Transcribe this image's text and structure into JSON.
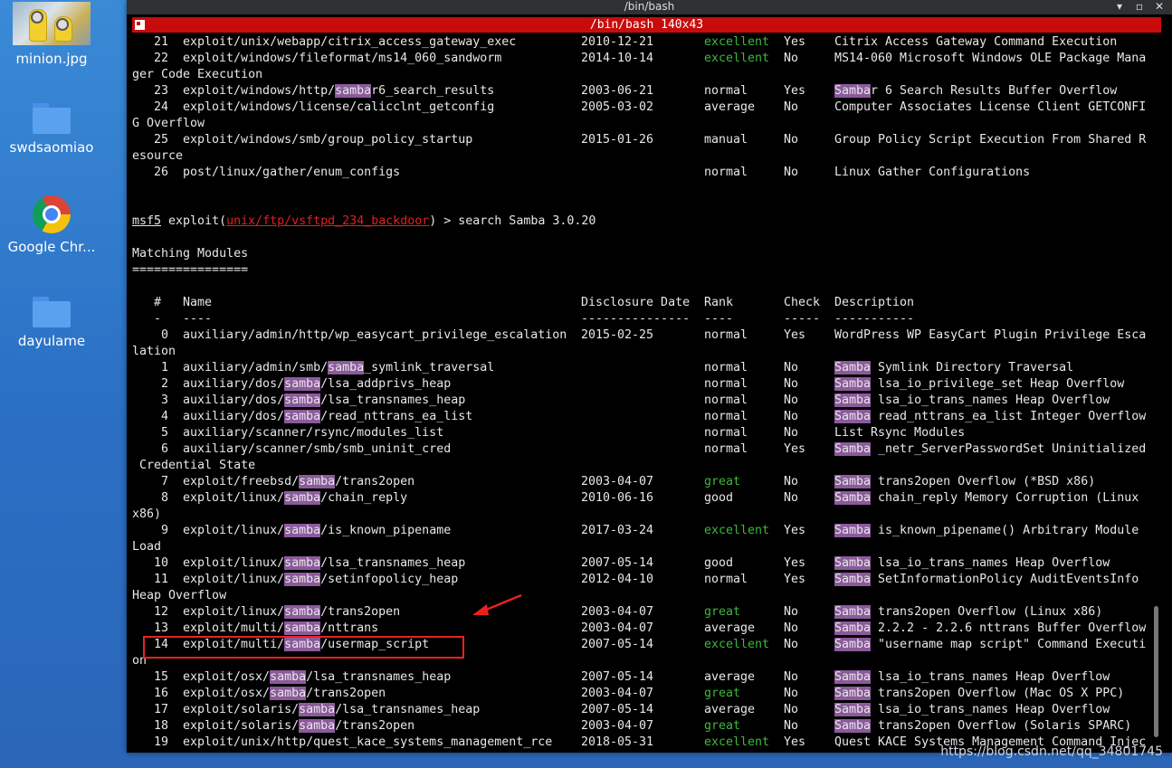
{
  "desktop": {
    "icons": [
      {
        "label": "minion.jpg",
        "icon": "image-thumbnail-icon"
      },
      {
        "label": "swdsaomiao",
        "icon": "folder-icon"
      },
      {
        "label": "Google Chr...",
        "icon": "chrome-icon"
      },
      {
        "label": "dayulame",
        "icon": "folder-icon"
      }
    ]
  },
  "window": {
    "title": "/bin/bash",
    "tab_title": "/bin/bash 140x43",
    "controls": [
      "▾",
      "▫",
      "✕"
    ]
  },
  "colors": {
    "accent_red": "#c80b0b",
    "highlight": "#8b5a9b",
    "rating_green": "#3cb83c",
    "annotation_red": "#e8231e"
  },
  "terminal": {
    "top_rows": [
      {
        "num": "21",
        "name": "exploit/unix/webapp/citrix_access_gateway_exec",
        "date": "2010-12-21",
        "rank": "excellent",
        "check": "Yes",
        "desc": "Citrix Access Gateway Command Execution"
      },
      {
        "num": "22",
        "name": "exploit/windows/fileformat/ms14_060_sandworm",
        "date": "2014-10-14",
        "rank": "excellent",
        "check": "No",
        "desc": "MS14-060 Microsoft Windows OLE Package Mana",
        "wrap": "ger Code Execution"
      },
      {
        "num": "23",
        "name_pre": "exploit/windows/http/",
        "name_hl": "samba",
        "name_post": "r6_search_results",
        "date": "2003-06-21",
        "rank": "normal",
        "check": "Yes",
        "desc_hl": "Samba",
        "desc": "r 6 Search Results Buffer Overflow"
      },
      {
        "num": "24",
        "name": "exploit/windows/license/calicclnt_getconfig",
        "date": "2005-03-02",
        "rank": "average",
        "check": "No",
        "desc": "Computer Associates License Client GETCONFI",
        "wrap": "G Overflow"
      },
      {
        "num": "25",
        "name": "exploit/windows/smb/group_policy_startup",
        "date": "2015-01-26",
        "rank": "manual",
        "check": "No",
        "desc": "Group Policy Script Execution From Shared R",
        "wrap": "esource"
      },
      {
        "num": "26",
        "name": "post/linux/gather/enum_configs",
        "date": "",
        "rank": "normal",
        "check": "No",
        "desc": "Linux Gather Configurations"
      }
    ],
    "prompt": {
      "msf": "msf5",
      "exploit_word": " exploit(",
      "module": "unix/ftp/vsftpd_234_backdoor",
      "rest": ") > search Samba 3.0.20"
    },
    "matching_title": "Matching Modules",
    "matching_underline": "================",
    "headers": {
      "num": "#",
      "name": "Name",
      "date": "Disclosure Date",
      "rank": "Rank",
      "check": "Check",
      "desc": "Description"
    },
    "header_rules": {
      "num": "-",
      "name": "----",
      "date": "---------------",
      "rank": "----",
      "check": "-----",
      "desc": "-----------"
    },
    "rows": [
      {
        "num": "0",
        "name": "auxiliary/admin/http/wp_easycart_privilege_escalation",
        "date": "2015-02-25",
        "rank": "normal",
        "check": "Yes",
        "desc": "WordPress WP EasyCart Plugin Privilege Esca",
        "wrap": "lation"
      },
      {
        "num": "1",
        "name_pre": "auxiliary/admin/smb/",
        "name_hl": "samba",
        "name_post": "_symlink_traversal",
        "date": "",
        "rank": "normal",
        "check": "No",
        "desc_hl": "Samba",
        "desc": " Symlink Directory Traversal"
      },
      {
        "num": "2",
        "name_pre": "auxiliary/dos/",
        "name_hl": "samba",
        "name_post": "/lsa_addprivs_heap",
        "date": "",
        "rank": "normal",
        "check": "No",
        "desc_hl": "Samba",
        "desc": " lsa_io_privilege_set Heap Overflow"
      },
      {
        "num": "3",
        "name_pre": "auxiliary/dos/",
        "name_hl": "samba",
        "name_post": "/lsa_transnames_heap",
        "date": "",
        "rank": "normal",
        "check": "No",
        "desc_hl": "Samba",
        "desc": " lsa_io_trans_names Heap Overflow"
      },
      {
        "num": "4",
        "name_pre": "auxiliary/dos/",
        "name_hl": "samba",
        "name_post": "/read_nttrans_ea_list",
        "date": "",
        "rank": "normal",
        "check": "No",
        "desc_hl": "Samba",
        "desc": " read_nttrans_ea_list Integer Overflow"
      },
      {
        "num": "5",
        "name": "auxiliary/scanner/rsync/modules_list",
        "date": "",
        "rank": "normal",
        "check": "No",
        "desc": "List Rsync Modules"
      },
      {
        "num": "6",
        "name": "auxiliary/scanner/smb/smb_uninit_cred",
        "date": "",
        "rank": "normal",
        "check": "Yes",
        "desc_hl": "Samba",
        "desc": " _netr_ServerPasswordSet Uninitialized",
        "wrap": " Credential State"
      },
      {
        "num": "7",
        "name_pre": "exploit/freebsd/",
        "name_hl": "samba",
        "name_post": "/trans2open",
        "date": "2003-04-07",
        "rank": "great",
        "check": "No",
        "desc_hl": "Samba",
        "desc": " trans2open Overflow (*BSD x86)"
      },
      {
        "num": "8",
        "name_pre": "exploit/linux/",
        "name_hl": "samba",
        "name_post": "/chain_reply",
        "date": "2010-06-16",
        "rank": "good",
        "check": "No",
        "desc_hl": "Samba",
        "desc": " chain_reply Memory Corruption (Linux",
        "wrap": "x86)"
      },
      {
        "num": "9",
        "name_pre": "exploit/linux/",
        "name_hl": "samba",
        "name_post": "/is_known_pipename",
        "date": "2017-03-24",
        "rank": "excellent",
        "check": "Yes",
        "desc_hl": "Samba",
        "desc": " is_known_pipename() Arbitrary Module",
        "wrap": "Load"
      },
      {
        "num": "10",
        "name_pre": "exploit/linux/",
        "name_hl": "samba",
        "name_post": "/lsa_transnames_heap",
        "date": "2007-05-14",
        "rank": "good",
        "check": "Yes",
        "desc_hl": "Samba",
        "desc": " lsa_io_trans_names Heap Overflow"
      },
      {
        "num": "11",
        "name_pre": "exploit/linux/",
        "name_hl": "samba",
        "name_post": "/setinfopolicy_heap",
        "date": "2012-04-10",
        "rank": "normal",
        "check": "Yes",
        "desc_hl": "Samba",
        "desc": " SetInformationPolicy AuditEventsInfo",
        "wrap": "Heap Overflow"
      },
      {
        "num": "12",
        "name_pre": "exploit/linux/",
        "name_hl": "samba",
        "name_post": "/trans2open",
        "date": "2003-04-07",
        "rank": "great",
        "check": "No",
        "desc_hl": "Samba",
        "desc": " trans2open Overflow (Linux x86)"
      },
      {
        "num": "13",
        "name_pre": "exploit/multi/",
        "name_hl": "samba",
        "name_post": "/nttrans",
        "date": "2003-04-07",
        "rank": "average",
        "check": "No",
        "desc_hl": "Samba",
        "desc": " 2.2.2 - 2.2.6 nttrans Buffer Overflow"
      },
      {
        "num": "14",
        "name_pre": "exploit/multi/",
        "name_hl": "samba",
        "name_post": "/usermap_script",
        "date": "2007-05-14",
        "rank": "excellent",
        "check": "No",
        "desc_hl": "Samba",
        "desc": " \"username map script\" Command Executi",
        "wrap": "on"
      },
      {
        "num": "15",
        "name_pre": "exploit/osx/",
        "name_hl": "samba",
        "name_post": "/lsa_transnames_heap",
        "date": "2007-05-14",
        "rank": "average",
        "check": "No",
        "desc_hl": "Samba",
        "desc": " lsa_io_trans_names Heap Overflow"
      },
      {
        "num": "16",
        "name_pre": "exploit/osx/",
        "name_hl": "samba",
        "name_post": "/trans2open",
        "date": "2003-04-07",
        "rank": "great",
        "check": "No",
        "desc_hl": "Samba",
        "desc": " trans2open Overflow (Mac OS X PPC)"
      },
      {
        "num": "17",
        "name_pre": "exploit/solaris/",
        "name_hl": "samba",
        "name_post": "/lsa_transnames_heap",
        "date": "2007-05-14",
        "rank": "average",
        "check": "No",
        "desc_hl": "Samba",
        "desc": " lsa_io_trans_names Heap Overflow"
      },
      {
        "num": "18",
        "name_pre": "exploit/solaris/",
        "name_hl": "samba",
        "name_post": "/trans2open",
        "date": "2003-04-07",
        "rank": "great",
        "check": "No",
        "desc_hl": "Samba",
        "desc": " trans2open Overflow (Solaris SPARC)"
      },
      {
        "num": "19",
        "name": "exploit/unix/http/quest_kace_systems_management_rce",
        "date": "2018-05-31",
        "rank": "excellent",
        "check": "Yes",
        "desc": "Quest KACE Systems Management Command Injec"
      }
    ]
  },
  "watermark": "https://blog.csdn.net/qq_34801745"
}
